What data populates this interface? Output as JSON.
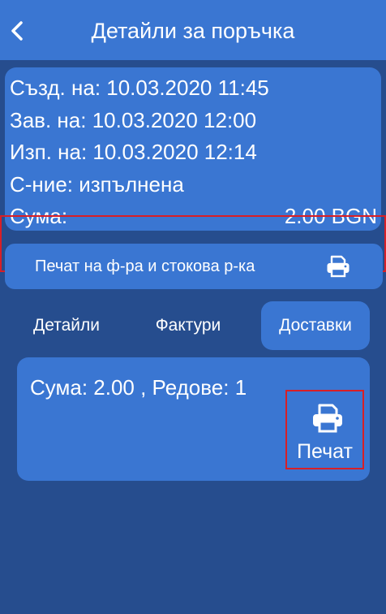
{
  "colors": {
    "background": "#264d8e",
    "panel": "#3a76d2",
    "highlight_border": "#d81f26",
    "text": "#ffffff"
  },
  "header": {
    "title": "Детайли за поръчка",
    "back_icon": "chevron-left-icon"
  },
  "summary": {
    "created": "Създ. на: 10.03.2020 11:45",
    "completed": "Зав. на: 10.03.2020 12:00",
    "executed": "Изп. на: 10.03.2020 12:14",
    "status": "С-ние: изпълнена",
    "sum_label": "Сума:",
    "sum_value": "2.00 BGN"
  },
  "print_invoice": {
    "label": "Печат на ф-ра и стокова р-ка",
    "icon": "printer-icon"
  },
  "tabs": [
    {
      "label": "Детайли",
      "active": false
    },
    {
      "label": "Фактури",
      "active": false
    },
    {
      "label": "Доставки",
      "active": true
    }
  ],
  "delivery_card": {
    "text": "Сума: 2.00 , Редове: 1",
    "print_label": "Печат",
    "icon": "printer-icon"
  }
}
